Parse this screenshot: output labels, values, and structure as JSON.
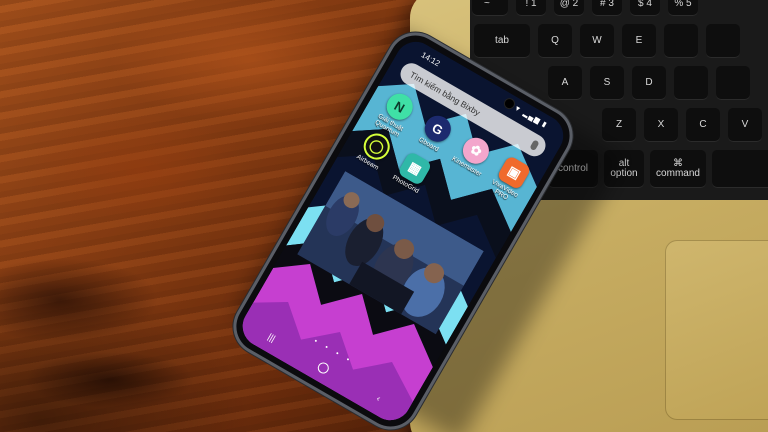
{
  "phone": {
    "status_time": "14:12",
    "status_icons": "▼ ▂▄▆ ▮",
    "search_placeholder": "Tìm kiếm bằng Bixby",
    "apps_row1": [
      {
        "label": "Giải thuật Quantum",
        "glyph": "N",
        "bg": "#3fe0a6",
        "fg": "#0c3a2a",
        "icon": "note-app-icon"
      },
      {
        "label": "Gboard",
        "glyph": "G",
        "bg": "#1c2a6e",
        "fg": "#ffffff",
        "icon": "g-app-icon"
      },
      {
        "label": "Kinemaster",
        "glyph": "✿",
        "bg": "#f3a6cc",
        "fg": "#ffffff",
        "icon": "flower-app-icon"
      },
      {
        "label": "VivaVideo PRO",
        "glyph": "▣",
        "bg": "#f06a2c",
        "fg": "#ffffff",
        "icon": "video-app-icon"
      }
    ],
    "apps_row2": [
      {
        "label": "Airbeam",
        "glyph": "◯",
        "bg": "#111111",
        "fg": "#d6ff3a",
        "icon": "ring-app-icon"
      },
      {
        "label": "PhotoGrid",
        "glyph": "▦",
        "bg": "#2fb8a8",
        "fg": "#ffffff",
        "icon": "grid-app-icon"
      }
    ],
    "nav": {
      "recent": "|||",
      "back": "‹"
    },
    "page_dots": "• • • •"
  },
  "laptop": {
    "keys": [
      {
        "label": "tab",
        "name": "key-tab"
      },
      {
        "label": "Q",
        "name": "key-q"
      },
      {
        "label": "W",
        "name": "key-w"
      },
      {
        "label": "E",
        "name": "key-e"
      },
      {
        "label": "A",
        "name": "key-a"
      },
      {
        "label": "S",
        "name": "key-s"
      },
      {
        "label": "D",
        "name": "key-d"
      },
      {
        "label": "Z",
        "name": "key-z"
      },
      {
        "label": "X",
        "name": "key-x"
      },
      {
        "label": "C",
        "name": "key-c"
      },
      {
        "label": "V",
        "name": "key-v"
      },
      {
        "label": "control",
        "name": "key-control"
      },
      {
        "label": "alt\noption",
        "name": "key-option"
      },
      {
        "label": "⌘\ncommand",
        "name": "key-command"
      },
      {
        "label": "!\n1",
        "name": "key-1"
      },
      {
        "label": "@\n2",
        "name": "key-2"
      },
      {
        "label": "#\n3",
        "name": "key-3"
      },
      {
        "label": "$\n4",
        "name": "key-4"
      },
      {
        "label": "%\n5",
        "name": "key-5"
      },
      {
        "label": "~\n`",
        "name": "key-tilde"
      }
    ]
  }
}
